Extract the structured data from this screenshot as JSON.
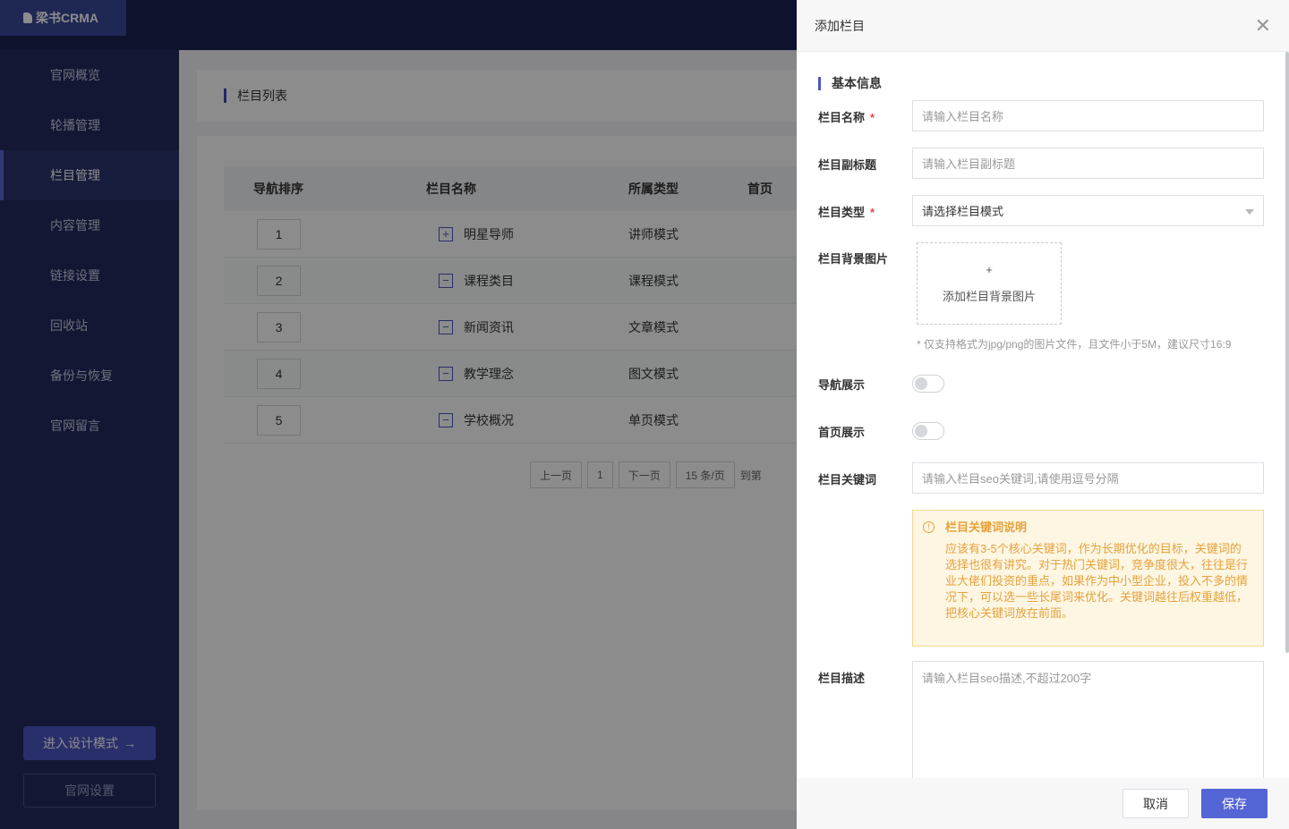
{
  "app": {
    "logo": "梁书CRMA"
  },
  "sidebar": {
    "items": [
      {
        "label": "官网概览"
      },
      {
        "label": "轮播管理"
      },
      {
        "label": "栏目管理",
        "active": true
      },
      {
        "label": "内容管理"
      },
      {
        "label": "链接设置"
      },
      {
        "label": "回收站"
      },
      {
        "label": "备份与恢复"
      },
      {
        "label": "官网留言"
      }
    ],
    "design_button": "进入设计模式",
    "settings_button": "官网设置"
  },
  "main": {
    "title": "栏目列表",
    "table": {
      "headers": [
        "导航排序",
        "栏目名称",
        "所属类型",
        "首页"
      ],
      "rows": [
        {
          "order": "1",
          "name": "明星导师",
          "type": "讲师模式",
          "icon": "+"
        },
        {
          "order": "2",
          "name": "课程类目",
          "type": "课程模式",
          "icon": "−"
        },
        {
          "order": "3",
          "name": "新闻资讯",
          "type": "文章模式",
          "icon": "−"
        },
        {
          "order": "4",
          "name": "教学理念",
          "type": "图文模式",
          "icon": "−"
        },
        {
          "order": "5",
          "name": "学校概况",
          "type": "单页模式",
          "icon": "−"
        }
      ]
    },
    "pager": {
      "prev": "上一页",
      "current": "1",
      "next": "下一页",
      "size": "15 条/页",
      "goto": "到第"
    }
  },
  "drawer": {
    "title": "添加栏目",
    "section": "基本信息",
    "fields": {
      "name": {
        "label": "栏目名称",
        "placeholder": "请输入栏目名称"
      },
      "subtitle": {
        "label": "栏目副标题",
        "placeholder": "请输入栏目副标题"
      },
      "type": {
        "label": "栏目类型",
        "placeholder": "请选择栏目模式"
      },
      "background": {
        "label": "栏目背景图片",
        "upload_plus": "+",
        "upload_text": "添加栏目背景图片",
        "hint": "* 仅支持格式为jpg/png的图片文件，且文件小于5M，建议尺寸16:9"
      },
      "nav_show": {
        "label": "导航展示"
      },
      "home_show": {
        "label": "首页展示"
      },
      "keywords": {
        "label": "栏目关键词",
        "placeholder": "请输入栏目seo关键词,请使用逗号分隔"
      },
      "notice": {
        "title": "栏目关键词说明",
        "body": "应该有3-5个核心关键词，作为长期优化的目标，关键词的选择也很有讲究。对于热门关键词，竞争度很大，往往是行业大佬们投资的重点，如果作为中小型企业，投入不多的情况下，可以选一些长尾词来优化。关键词越往后权重越低，把核心关键词放在前面。"
      },
      "description": {
        "label": "栏目描述",
        "placeholder": "请输入栏目seo描述,不超过200字"
      }
    },
    "required_mark": "*",
    "cancel": "取消",
    "save": "保存"
  },
  "colors": {
    "primary": "#4b57c4",
    "sidebar": "#242a5e",
    "warning": "#e6a23c"
  }
}
